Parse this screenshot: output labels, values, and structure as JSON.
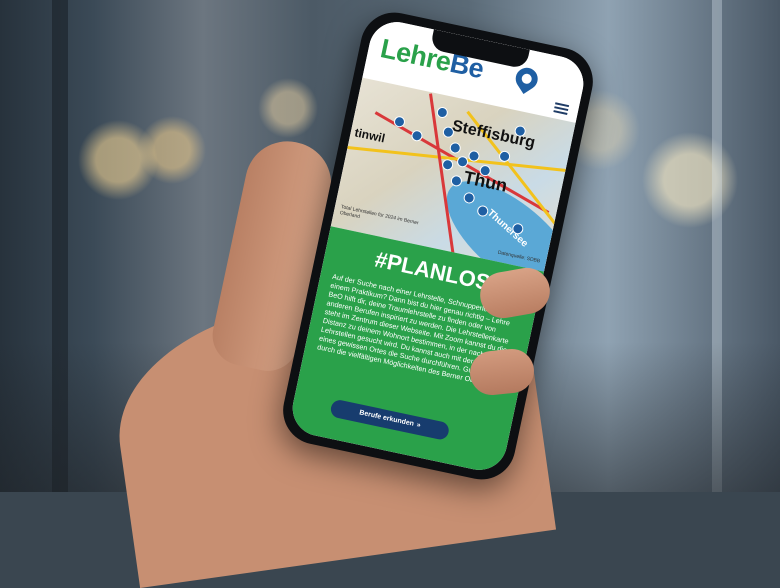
{
  "app": {
    "logo_left": "Lehre",
    "logo_right": "Be"
  },
  "map": {
    "place_labels": [
      "Steffisburg",
      "Thun",
      "tinwil",
      "Thunersee"
    ],
    "caption_left": "Total Lehrstellen für 2024 im Berner Oberland",
    "caption_right": "Datenquelle: SDBB"
  },
  "promo": {
    "headline": "#PLANLOS",
    "text": "Auf der Suche nach einer Lehrstelle, Schnupperlehre oder einem Praktikum? Dann bist du hier genau richtig – Lehre BeO hilft dir, deine Traumlehrstelle zu finden oder von anderen Berufen inspiriert zu werden. Die Lehrstellenkarte steht im Zentrum dieser Webseite. Mit Zoom kannst du die Distanz zu deinem Wohnort bestimmen, in der nach freien Lehrstellen gesucht wird. Du kannst auch mit der Eingabe eines gewissen Ortes die Suche durchführen. Gute Reise durch die vielfältigen Möglichkeiten des Berner Oberlands!",
    "button_label": "Berufe erkunden"
  },
  "colors": {
    "green": "#2aa14a",
    "blue": "#1f5fa3",
    "button": "#173c6e"
  }
}
